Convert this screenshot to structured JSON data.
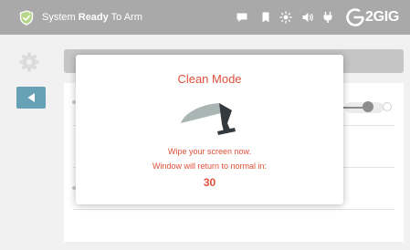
{
  "status_bar": {
    "status_prefix": "System",
    "status_strong": "Ready",
    "status_suffix": "To Arm",
    "brand": "2GIG",
    "icons": [
      "shield-check-icon",
      "message-icon",
      "bookmark-icon",
      "brightness-icon",
      "volume-icon",
      "plug-icon",
      "brand-logo-icon"
    ],
    "colors": {
      "bar": "#a9a9a9",
      "text": "#ffffff",
      "shield": "#b7d68c"
    }
  },
  "background": {
    "icons": [
      "gear-icon",
      "back-arrow-icon"
    ],
    "colors": {
      "back_button": "#67a1b5",
      "panel": "#ffffff",
      "page": "#f1f1f1"
    }
  },
  "modal": {
    "title": "Clean Mode",
    "message_line1": "Wipe your screen now.",
    "message_line2": "Window will return to normal in:",
    "countdown": "30",
    "icon": "wiper-icon",
    "colors": {
      "accent": "#e1503a",
      "wiper_blade": "#a9b6b4",
      "wiper_arm": "#34393d"
    }
  }
}
